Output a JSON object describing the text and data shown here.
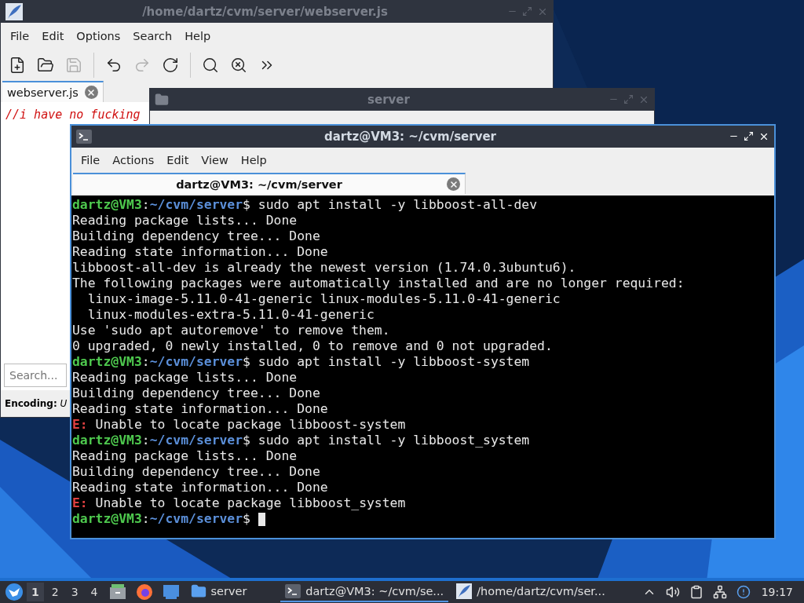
{
  "editor_window": {
    "title": "/home/dartz/cvm/server/webserver.js",
    "menu": [
      "File",
      "Edit",
      "Options",
      "Search",
      "Help"
    ],
    "toolbar": [
      {
        "kind": "new",
        "disabled": false
      },
      {
        "kind": "open",
        "disabled": false
      },
      {
        "kind": "save",
        "disabled": true
      },
      {
        "kind": "sep"
      },
      {
        "kind": "undo",
        "disabled": false
      },
      {
        "kind": "redo",
        "disabled": true
      },
      {
        "kind": "reload",
        "disabled": false
      },
      {
        "kind": "sep"
      },
      {
        "kind": "find",
        "disabled": false
      },
      {
        "kind": "replace",
        "disabled": false
      },
      {
        "kind": "more",
        "disabled": false
      }
    ],
    "tab": {
      "label": "webserver.js"
    },
    "text": "//i have no fucking",
    "search": {
      "placeholder": "Search..."
    },
    "encoding": {
      "label": "Encoding:",
      "value": "U"
    }
  },
  "file_manager_window": {
    "title": "server"
  },
  "terminal_window": {
    "title": "dartz@VM3: ~/cvm/server",
    "menu": [
      "File",
      "Actions",
      "Edit",
      "View",
      "Help"
    ],
    "tab": {
      "label": "dartz@VM3: ~/cvm/server"
    },
    "lines": [
      {
        "kind": "prompt",
        "user": "dartz@VM3",
        "separator": ":",
        "path": "~/cvm/server",
        "command": "$ sudo apt install -y libboost-all-dev"
      },
      {
        "kind": "output",
        "text": "Reading package lists... Done"
      },
      {
        "kind": "output",
        "text": "Building dependency tree... Done"
      },
      {
        "kind": "output",
        "text": "Reading state information... Done"
      },
      {
        "kind": "output",
        "text": "libboost-all-dev is already the newest version (1.74.0.3ubuntu6)."
      },
      {
        "kind": "output",
        "text": "The following packages were automatically installed and are no longer required:"
      },
      {
        "kind": "output",
        "text": "  linux-image-5.11.0-41-generic linux-modules-5.11.0-41-generic"
      },
      {
        "kind": "output",
        "text": "  linux-modules-extra-5.11.0-41-generic"
      },
      {
        "kind": "output",
        "text": "Use 'sudo apt autoremove' to remove them."
      },
      {
        "kind": "output",
        "text": "0 upgraded, 0 newly installed, 0 to remove and 0 not upgraded."
      },
      {
        "kind": "prompt",
        "user": "dartz@VM3",
        "separator": ":",
        "path": "~/cvm/server",
        "command": "$ sudo apt install -y libboost-system"
      },
      {
        "kind": "output",
        "text": "Reading package lists... Done"
      },
      {
        "kind": "output",
        "text": "Building dependency tree... Done"
      },
      {
        "kind": "output",
        "text": "Reading state information... Done"
      },
      {
        "kind": "error",
        "tag": "E:",
        "text": "Unable to locate package libboost-system"
      },
      {
        "kind": "prompt",
        "user": "dartz@VM3",
        "separator": ":",
        "path": "~/cvm/server",
        "command": "$ sudo apt install -y libboost_system"
      },
      {
        "kind": "output",
        "text": "Reading package lists... Done"
      },
      {
        "kind": "output",
        "text": "Building dependency tree... Done"
      },
      {
        "kind": "output",
        "text": "Reading state information... Done"
      },
      {
        "kind": "error",
        "tag": "E:",
        "text": "Unable to locate package libboost_system"
      },
      {
        "kind": "prompt",
        "user": "dartz@VM3",
        "separator": ":",
        "path": "~/cvm/server",
        "command": "$",
        "cursor": true
      }
    ]
  },
  "taskbar": {
    "workspaces": [
      {
        "label": "1",
        "selected": true
      },
      {
        "label": "2",
        "selected": false
      },
      {
        "label": "3",
        "selected": false
      },
      {
        "label": "4",
        "selected": false
      }
    ],
    "launchers": [
      {
        "kind": "files"
      },
      {
        "kind": "browser"
      },
      {
        "kind": "desktop"
      }
    ],
    "tasks": [
      {
        "kind": "folder",
        "label": "server",
        "selected": false
      },
      {
        "kind": "terminal",
        "label": "dartz@VM3: ~/cvm/se...",
        "selected": true
      },
      {
        "kind": "editor",
        "label": "/home/dartz/cvm/ser...",
        "selected": false
      }
    ],
    "clock": "19:17"
  }
}
